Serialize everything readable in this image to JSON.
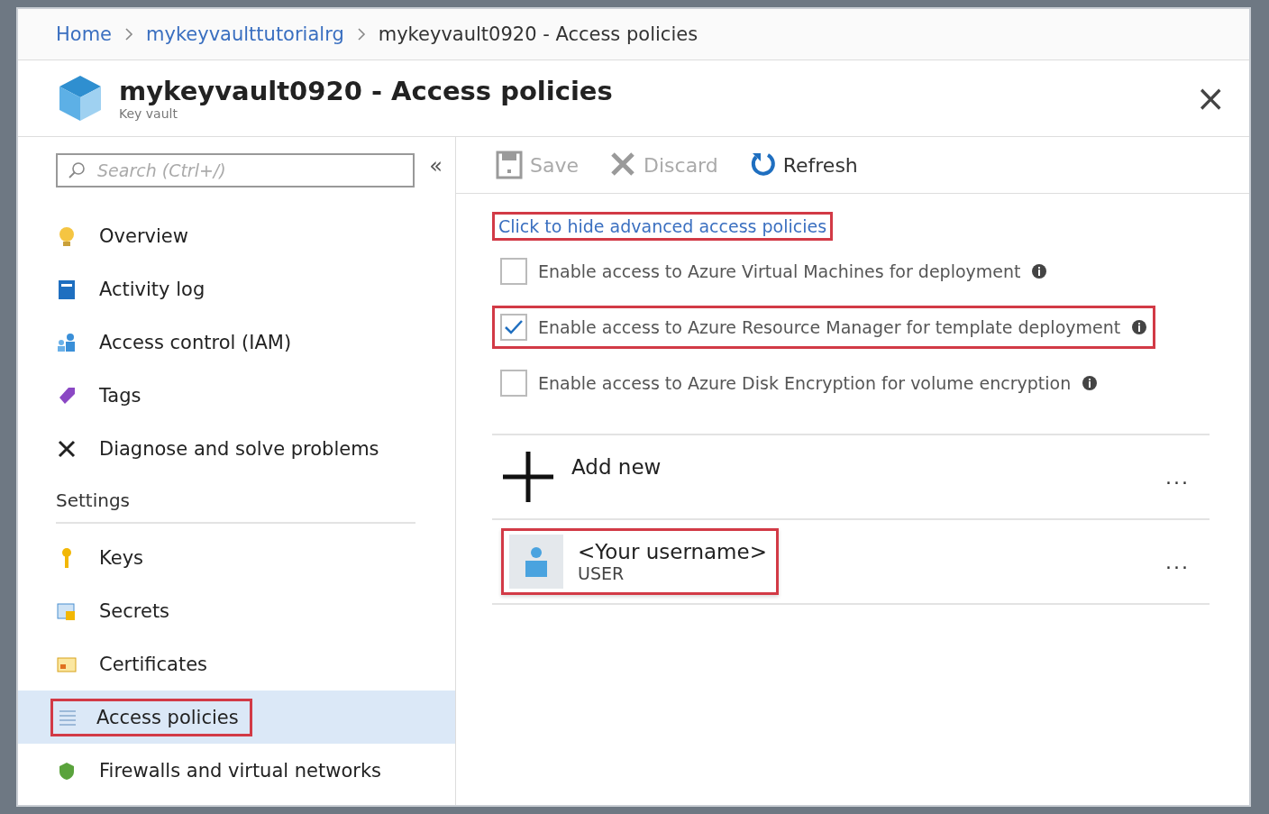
{
  "breadcrumb": [
    {
      "label": "Home",
      "link": true
    },
    {
      "label": "mykeyvaulttutorialrg",
      "link": true
    },
    {
      "label": "mykeyvault0920 - Access policies",
      "link": false
    }
  ],
  "header": {
    "title": "mykeyvault0920 - Access policies",
    "subtitle": "Key vault",
    "close": "×"
  },
  "sidebar": {
    "search": {
      "placeholder": "Search (Ctrl+/)"
    },
    "collapse": "«",
    "items": [
      {
        "label": "Overview",
        "selected": false,
        "highlighted": false
      },
      {
        "label": "Activity log",
        "selected": false,
        "highlighted": false
      },
      {
        "label": "Access control (IAM)",
        "selected": false,
        "highlighted": false
      },
      {
        "label": "Tags",
        "selected": false,
        "highlighted": false
      },
      {
        "label": "Diagnose and solve problems",
        "selected": false,
        "highlighted": false
      }
    ],
    "sections": [
      {
        "title": "Settings",
        "items": [
          {
            "label": "Keys",
            "selected": false,
            "highlighted": false
          },
          {
            "label": "Secrets",
            "selected": false,
            "highlighted": false
          },
          {
            "label": "Certificates",
            "selected": false,
            "highlighted": false
          },
          {
            "label": "Access policies",
            "selected": true,
            "highlighted": true
          },
          {
            "label": "Firewalls and virtual networks",
            "selected": false,
            "highlighted": false
          }
        ]
      }
    ]
  },
  "toolbar": [
    {
      "label": "Save",
      "disabled": true
    },
    {
      "label": "Discard",
      "disabled": true
    },
    {
      "label": "Refresh",
      "disabled": false
    }
  ],
  "advanced_link": {
    "label": "Click to hide advanced access policies",
    "highlighted": true
  },
  "options": [
    {
      "label": "Enable access to Azure Virtual Machines for deployment",
      "checked": false,
      "highlighted": false
    },
    {
      "label": "Enable access to Azure Resource Manager for template deployment",
      "checked": true,
      "highlighted": true
    },
    {
      "label": "Enable access to Azure Disk Encryption for volume encryption",
      "checked": false,
      "highlighted": false
    }
  ],
  "add_new": {
    "label": "Add new",
    "more": "..."
  },
  "policies": [
    {
      "name": "<Your username>",
      "type": "USER",
      "more": "...",
      "highlighted": true
    }
  ]
}
